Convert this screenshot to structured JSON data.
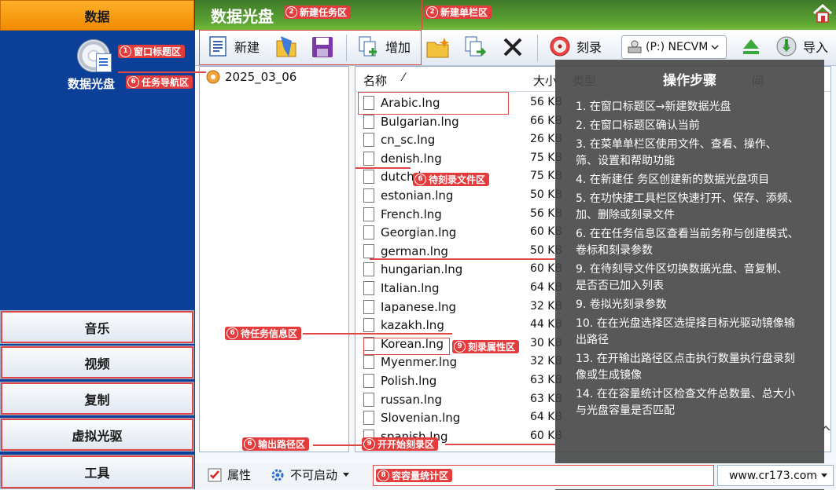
{
  "sidebar": {
    "tabs": [
      "数据",
      "音乐",
      "视频",
      "复制",
      "虚拟光驱",
      "工具"
    ],
    "disc_label": "数据光盘"
  },
  "header": {
    "title": "数据光盘"
  },
  "toolbar": {
    "new_label": "新建",
    "add_label": "增加",
    "burn_label": "刻录",
    "drive_value": "(P:) NECVM",
    "import_label": "导入"
  },
  "tree": {
    "project": "2025_03_06"
  },
  "filelist": {
    "col_name": "名称",
    "col_size": "大小",
    "col_type": "类型",
    "col_time": "间",
    "files": [
      {
        "name": "Arabic.lng",
        "size": "56 KB"
      },
      {
        "name": "Bulgarian.lng",
        "size": "66 KB"
      },
      {
        "name": "cn_sc.lng",
        "size": "26 KB"
      },
      {
        "name": "denish.lng",
        "size": "75 KB"
      },
      {
        "name": "dutch.lng",
        "size": "75 KB"
      },
      {
        "name": "estonian.lng",
        "size": "50 KB"
      },
      {
        "name": "French.lng",
        "size": "56 KB"
      },
      {
        "name": "Georgian.lng",
        "size": "60 KB"
      },
      {
        "name": "german.lng",
        "size": "50 KB"
      },
      {
        "name": "hungarian.lng",
        "size": "60 KB"
      },
      {
        "name": "Italian.lng",
        "size": "64 KB"
      },
      {
        "name": "Iapanese.lng",
        "size": "32 KB"
      },
      {
        "name": "kazakh.lng",
        "size": "44 KB"
      },
      {
        "name": "Korean.lng",
        "size": "30 KB"
      },
      {
        "name": "Myenmer.lng",
        "size": "32 KB"
      },
      {
        "name": "Polish.lng",
        "size": "63 KB"
      },
      {
        "name": "russan.lng",
        "size": "63 KB"
      },
      {
        "name": "Slovenian.lng",
        "size": "64 KB"
      },
      {
        "name": "spanish.lng",
        "size": "60 KB"
      }
    ]
  },
  "overlay": {
    "title": "操作步骤",
    "steps": [
      "1. 在窗口标题区→新建数据光盘",
      "2. 在窗口标题区确认当前",
      "3. 在菜单单栏区使用文件、查看、操作、\n  筛、设置和帮助功能",
      "4. 在新建任 务区创建新的数据光盘项目",
      "5. 在功快捷工具栏区快速打开、保存、添频、\n加、删除或刻录文件",
      "6. 在在任务信息区查看当前务称与创建模式、\n卷标和刻录参数",
      "9. 在待刻导文件区切换数据光盘、音复制、\n  是否否已加入列表",
      "9. 卷拟光刻录参数",
      "10. 在在光盘选择区选提择目标光驱动镜像输\n  出路径",
      "13. 在开输出路径区点击执行数量执行盘录刻\n  像或生成镜像",
      "14. 在在容量统计区检查文件总数量、总大小\n与光盘容量是否匹配"
    ]
  },
  "annotations": {
    "window_title": "窗口标题区",
    "new_task": "新建任务区",
    "menu_bar": "新建单栏区",
    "task_nav": "任务导航区",
    "pending_files": "待刻录文件区",
    "task_info": "待任务信息区",
    "burn_props": "刻录属性区",
    "output_path": "输出路径区",
    "start_burn": "开开始刻录区",
    "capacity": "容容量统计区"
  },
  "bottombar": {
    "props_label": "属性",
    "boot_label": "不可启动",
    "site": "www.cr173.com"
  },
  "colors": {
    "sidebar_blue": "#0b3f98",
    "active_tab": "#f28a00",
    "header_green": "#5aa132",
    "annotation_red": "#e43c3c"
  }
}
